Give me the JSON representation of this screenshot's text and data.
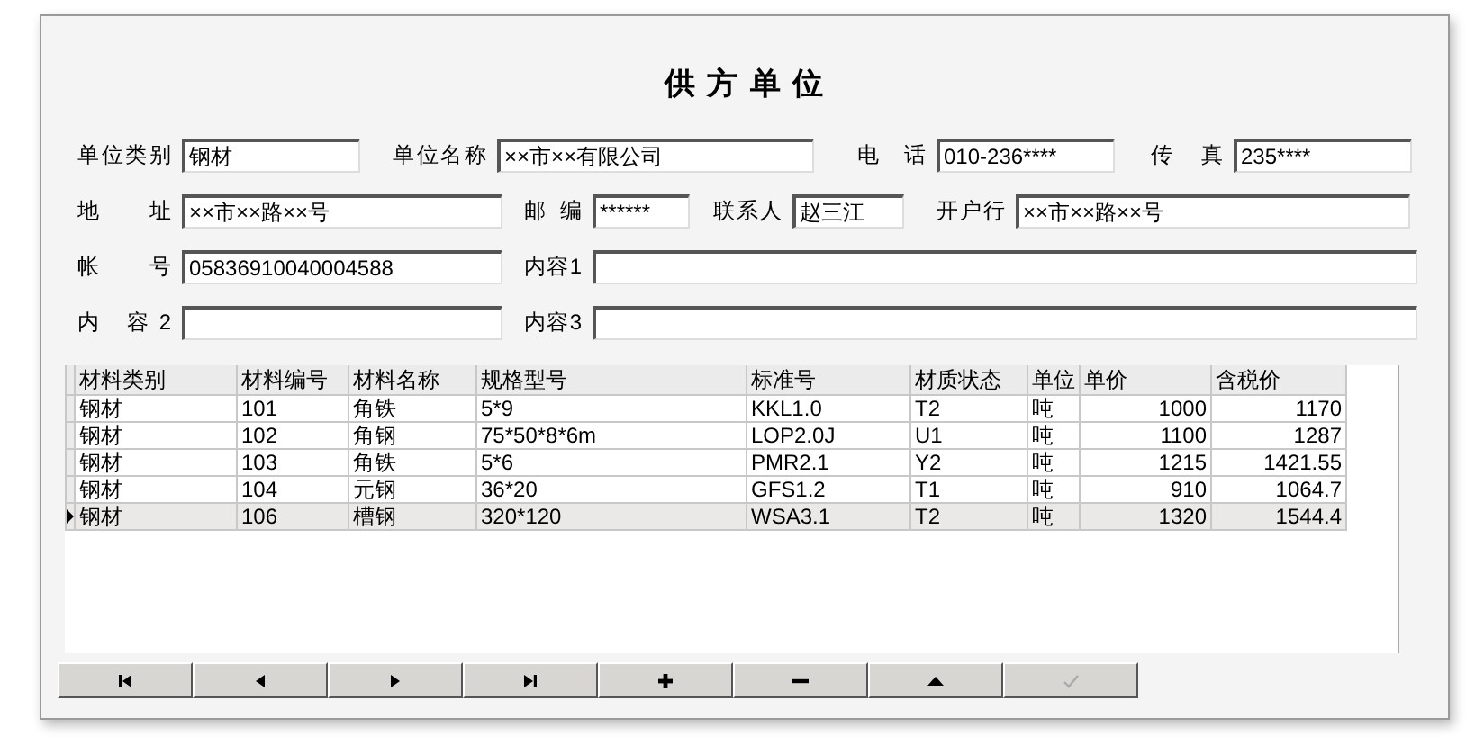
{
  "window": {
    "title": "供 方 单 位"
  },
  "form_rows": [
    [
      {
        "label": "单位类别",
        "value": "钢材"
      },
      {
        "label": "单位名称",
        "value": "××市××有限公司"
      },
      {
        "label": "电 话",
        "value": "010-236****"
      },
      {
        "label": "传 真",
        "value": "235****"
      }
    ],
    [
      {
        "label": "地 址",
        "value": "××市××路××号"
      },
      {
        "label": "邮 编",
        "value": "******"
      },
      {
        "label": "联系人",
        "value": "赵三江"
      },
      {
        "label": "开户行",
        "value": "××市××路××号"
      }
    ],
    [
      {
        "label": "帐 号",
        "value": "05836910040004588"
      },
      {
        "label": "内容1"
      }
    ],
    [
      {
        "label": "内 容2"
      },
      {
        "label": "内容3"
      }
    ]
  ],
  "table": {
    "columns": [
      "材料类别",
      "材料编号",
      "材料名称",
      "规格型号",
      "标准号",
      "材质状态",
      "单位",
      "单价",
      "含税价"
    ],
    "rows": [
      {
        "cells": [
          "钢材",
          "101",
          "角铁",
          "5*9",
          "KKL1.0",
          "T2",
          "吨",
          "1000",
          "1170"
        ],
        "selected": false
      },
      {
        "cells": [
          "钢材",
          "102",
          "角钢",
          "75*50*8*6m",
          "LOP2.0J",
          "U1",
          "吨",
          "1100",
          "1287"
        ],
        "selected": false
      },
      {
        "cells": [
          "钢材",
          "103",
          "角铁",
          "5*6",
          "PMR2.1",
          "Y2",
          "吨",
          "1215",
          "1421.55"
        ],
        "selected": false
      },
      {
        "cells": [
          "钢材",
          "104",
          "元钢",
          "36*20",
          "GFS1.2",
          "T1",
          "吨",
          "910",
          "1064.7"
        ],
        "selected": false
      },
      {
        "cells": [
          "钢材",
          "106",
          "槽钢",
          "320*120",
          "WSA3.1",
          "T2",
          "吨",
          "1320",
          "1544.4"
        ],
        "selected": true
      }
    ]
  },
  "navigator": [
    {
      "kind": "first",
      "disabled": false
    },
    {
      "kind": "prior",
      "disabled": false
    },
    {
      "kind": "next",
      "disabled": false
    },
    {
      "kind": "last",
      "disabled": false
    },
    {
      "kind": "insert",
      "disabled": false
    },
    {
      "kind": "delete",
      "disabled": false
    },
    {
      "kind": "edit",
      "disabled": false
    },
    {
      "kind": "post",
      "disabled": true
    }
  ]
}
